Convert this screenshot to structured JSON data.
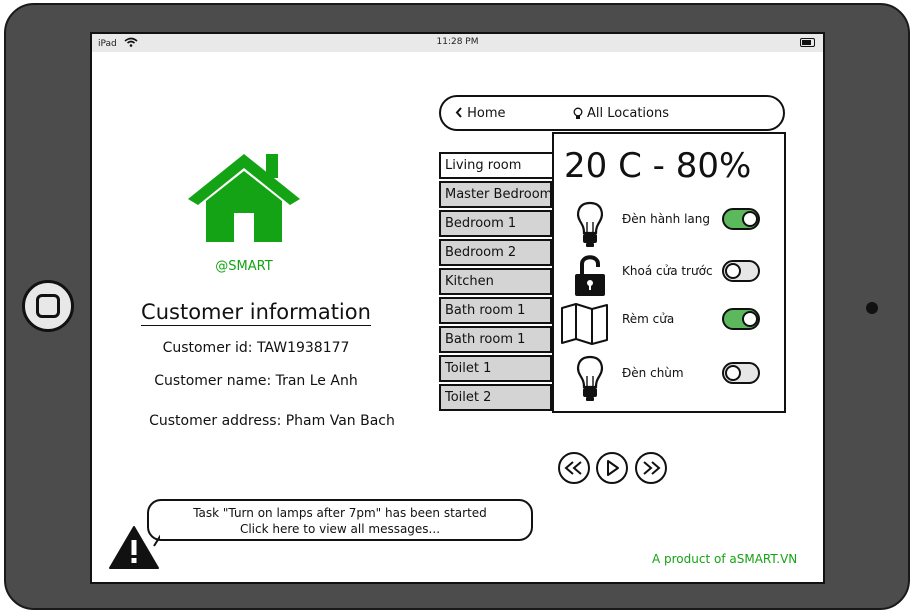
{
  "statusbar": {
    "device": "iPad",
    "time": "11:28 PM"
  },
  "brand": {
    "name": "@SMART",
    "color": "#14a314"
  },
  "customer": {
    "title": "Customer information",
    "id": "Customer id: TAW1938177",
    "name": "Customer name: Tran Le Anh",
    "address": "Customer address: Pham Van Bach"
  },
  "nav": {
    "home": "Home",
    "locations": "All Locations"
  },
  "rooms": [
    "Living room",
    "Master Bedroom",
    "Bedroom 1",
    "Bedroom 2",
    "Kitchen",
    "Bath room 1",
    "Bath room 1",
    "Toilet 1",
    "Toilet 2"
  ],
  "active_room": "Living room",
  "climate": "20 C - 80%",
  "devices": [
    {
      "label": "Đèn hành lang",
      "icon": "lightbulb-icon",
      "on": true
    },
    {
      "label": "Khoá cửa trước",
      "icon": "unlock-icon",
      "on": false
    },
    {
      "label": "Rèm cửa",
      "icon": "map-curtain-icon",
      "on": true
    },
    {
      "label": "Đèn chùm",
      "icon": "lightbulb-icon",
      "on": false
    }
  ],
  "toggle_colors": {
    "on": "#5cb85c",
    "off": "#e6e6e6"
  },
  "message": {
    "line1": "Task \"Turn on lamps after 7pm\" has been started",
    "line2": "Click here to view all messages..."
  },
  "footer": {
    "product": "A product of aSMART.VN"
  }
}
